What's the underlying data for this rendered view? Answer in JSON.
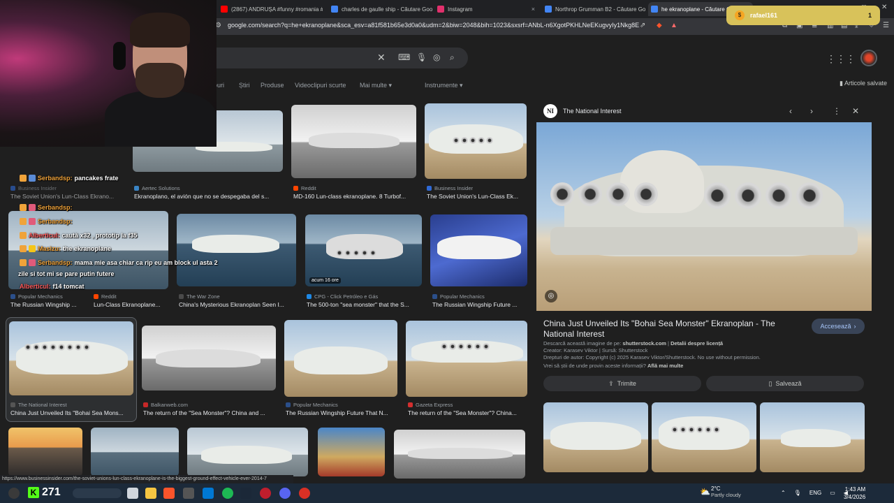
{
  "tabs": [
    {
      "label": "(2867) ANDRUȘA #funny #romania #",
      "color": "#ff0000"
    },
    {
      "label": "charles de gaulle ship - Căutare Goo",
      "color": "#4285f4"
    },
    {
      "label": "Instagram",
      "color": "#e1306c"
    },
    {
      "label": "Northrop Grumman B2 - Căutare Go",
      "color": "#4285f4"
    },
    {
      "label": "he ekranoplane - Căutare Goo",
      "color": "#4285f4"
    }
  ],
  "url": "google.com/search?q=he+ekranoplane&sca_esv=a81f581b65e3d0a0&udm=2&biw=2048&bih=1023&sxsrf=ANbL-n6XgotPKHLNeEKugvyIy1Nkg8E...",
  "nav_tabs": [
    "puri",
    "Știri",
    "Produse",
    "Videoclipuri scurte",
    "Mai multe ▾",
    "Instrumente ▾"
  ],
  "saved_label": "Articole salvate",
  "grid": [
    {
      "source": "Business Insider",
      "caption": "The Soviet Union's Lun-Class Ekrano...",
      "src_color": "#2f6ad6"
    },
    {
      "source": "Aertec Solutions",
      "caption": "Ekranoplano, el avión que no se despegaba del s...",
      "src_color": "#3a84c4"
    },
    {
      "source": "Reddit",
      "caption": "MD-160 Lun-class ekranoplane. 8 Turbof...",
      "src_color": "#ff4500"
    },
    {
      "source": "Business Insider",
      "caption": "The Soviet Union's Lun-Class Ek...",
      "src_color": "#2f6ad6"
    },
    {
      "source": "Popular Mechanics",
      "caption": "The Russian Wingship ...",
      "src_color": "#2b4f8a"
    },
    {
      "source": "Reddit",
      "caption": "Lun-Class Ekranoplane...",
      "src_color": "#ff4500"
    },
    {
      "source": "The War Zone",
      "caption": "China's Mysterious Ekranoplan Seen I...",
      "src_color": "#4a4a4a"
    },
    {
      "source": "CPG - Click Petróleo e Gás",
      "caption": "The 500-ton \"sea monster\" that the S...",
      "src_color": "#1e88e5"
    },
    {
      "source": "Popular Mechanics",
      "caption": "The Russian Wingship Future ...",
      "src_color": "#2b4f8a"
    },
    {
      "source": "The National Interest",
      "caption": "China Just Unveiled Its \"Bohai Sea Mons...",
      "src_color": "#555555"
    },
    {
      "source": "Balkanweb.com",
      "caption": "The return of the \"Sea Monster\"? China and ...",
      "src_color": "#c62828"
    },
    {
      "source": "Popular Mechanics",
      "caption": "The Russian Wingship Future That N...",
      "src_color": "#2b4f8a"
    },
    {
      "source": "Gazeta Express",
      "caption": "The return of the \"Sea Monster\"? China...",
      "src_color": "#d32f2f"
    }
  ],
  "timestamp_badge": "acum 16 ore",
  "panel": {
    "logo": "NI",
    "site": "The National Interest",
    "title": "China Just Unveiled Its \"Bohai Sea Monster\" Ekranoplan - The National Interest",
    "visit": "Accesează",
    "dl_prefix": "Descarcă această imagine de pe:",
    "dl_site": "shutterstock.com",
    "dl_link": "Detalii despre licență",
    "creator": "Creator: Karasev Viktor | Sursă: Shutterstock",
    "copyright": "Drepturi de autor: Copyright (c) 2025 Karasev Viktor/Shutterstock. No use without permission.",
    "learn_prefix": "Vrei să știi de unde provin aceste informații?",
    "learn_link": "Află mai multe",
    "share": "Trimite",
    "save": "Salvează"
  },
  "notification": {
    "name": "rafael161",
    "count": "1"
  },
  "chat": [
    {
      "user": "Serbandsp:",
      "text": "pancakes frate",
      "red": false
    },
    {
      "user": "Serbandsp:",
      "text": "",
      "red": false
    },
    {
      "user": "Serbandsp:",
      "text": "",
      "red": false
    },
    {
      "user": "Alberticul:",
      "text": "caută x32 , prototip la f35",
      "red": true
    },
    {
      "user": "Masizu:",
      "text": "the ekranoplane",
      "red": false
    },
    {
      "user": "Serbandsp:",
      "text": "mama mie asa chiar ca rip eu am block ul asta 2",
      "red": false
    },
    {
      "user": "",
      "text": "zile si tot mi se pare putin futere",
      "red": false
    },
    {
      "user": "Alberticul:",
      "text": "f14 tomcat",
      "red": true
    }
  ],
  "status_url": "https://www.businessinsider.com/the-soviet-unions-lun-class-ekranoplane-is-the-biggest-ground-effect-vehicle-ever-2014-7",
  "taskbar": {
    "kick_count": "271",
    "temp": "2°C",
    "weather": "Partly cloudy",
    "lang": "ENG",
    "time": "1:43 AM",
    "date": "3/4/2026"
  }
}
